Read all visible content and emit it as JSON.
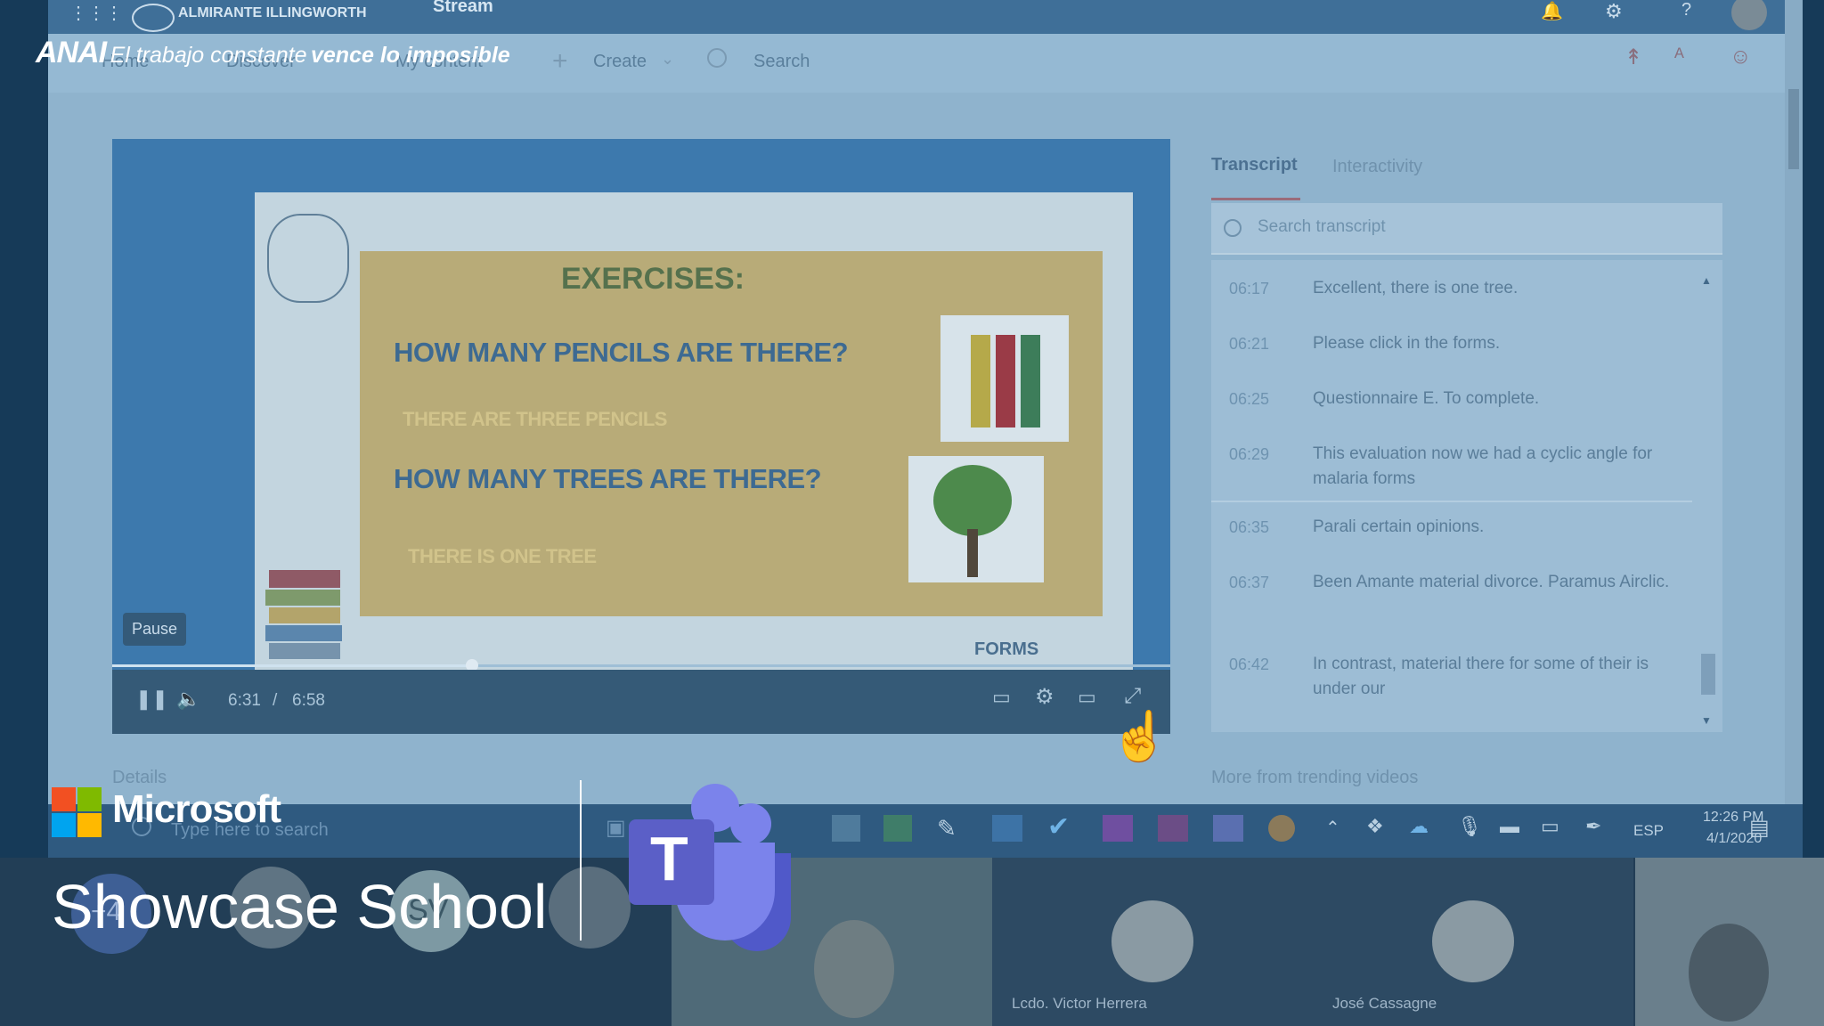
{
  "brand": {
    "anai_logo": "ANAI",
    "tagline_prefix": "El trabajo constante",
    "tagline_bold": "vence lo imposible",
    "microsoft": "Microsoft",
    "school_title": "Showcase School"
  },
  "topbar": {
    "org": "ALMIRANTE ILLINGWORTH",
    "app": "Stream"
  },
  "nav": {
    "home": "Home",
    "discover": "Discover",
    "my_content": "My content",
    "create": "Create",
    "search": "Search"
  },
  "slide": {
    "title": "EXERCISES:",
    "q1": "HOW MANY PENCILS ARE THERE?",
    "a1": "THERE ARE THREE PENCILS",
    "q2": "HOW MANY TREES ARE THERE?",
    "a2": "THERE IS ONE TREE",
    "forms": "FORMS"
  },
  "player": {
    "tooltip": "Pause",
    "current_time": "6:31",
    "separator": "/",
    "duration": "6:58",
    "progress": 0.34
  },
  "transcript": {
    "tab_transcript": "Transcript",
    "tab_interactivity": "Interactivity",
    "search_placeholder": "Search transcript",
    "rows": [
      {
        "time": "06:17",
        "text": "Excellent, there is one tree."
      },
      {
        "time": "06:21",
        "text": "Please click in the forms."
      },
      {
        "time": "06:25",
        "text": "Questionnaire E. To complete."
      },
      {
        "time": "06:29",
        "text": "This evaluation now we had a cyclic angle for malaria forms"
      },
      {
        "time": "06:35",
        "text": "Parali certain opinions."
      },
      {
        "time": "06:37",
        "text": "Been Amante material divorce. Paramus Airclic."
      },
      {
        "time": "06:42",
        "text": "In contrast, material there for some of their is under our"
      }
    ]
  },
  "details": {
    "label": "Details",
    "more_trending": "More from trending videos"
  },
  "taskbar": {
    "search_placeholder": "Type here to search",
    "lang": "ESP",
    "time": "12:26 PM",
    "date": "4/1/2020"
  },
  "participants": {
    "overflow": "+4",
    "sv_initials": "SV",
    "person1": "Lcdo. Victor Herrera",
    "person2": "José Cassagne"
  },
  "colors": {
    "accent": "#3f6f98",
    "teams_purple": "#5b5fc7",
    "overlay_blue": "#163a58"
  }
}
